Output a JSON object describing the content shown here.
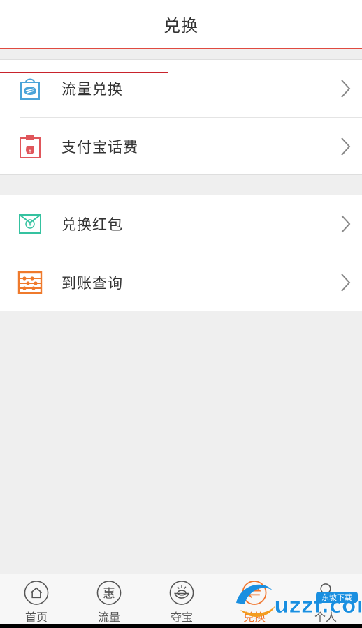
{
  "header": {
    "title": "兑换"
  },
  "groups": [
    {
      "items": [
        {
          "label": "流量兑换",
          "icon": "traffic-exchange-icon",
          "color": "#4aa3d8"
        },
        {
          "label": "支付宝话费",
          "icon": "alipay-bill-icon",
          "color": "#e0565b"
        }
      ]
    },
    {
      "items": [
        {
          "label": "兑换红包",
          "icon": "red-envelope-icon",
          "color": "#35c2a0"
        },
        {
          "label": "到账查询",
          "icon": "abacus-icon",
          "color": "#ef7a2c"
        }
      ]
    }
  ],
  "tabbar": {
    "tabs": [
      {
        "label": "首页",
        "icon": "home-icon"
      },
      {
        "label": "流量",
        "icon": "hui-icon",
        "icon_text": "惠"
      },
      {
        "label": "夺宝",
        "icon": "treasure-icon"
      },
      {
        "label": "兑换",
        "icon": "exchange-icon",
        "active": true
      },
      {
        "label": "个人",
        "icon": "person-icon"
      }
    ]
  },
  "watermark": {
    "text": "uzzf.com",
    "badge": "东坡下载"
  },
  "colors": {
    "accent": "#f0732a",
    "highlight": "#c8232c",
    "header_border": "#e04a40"
  }
}
